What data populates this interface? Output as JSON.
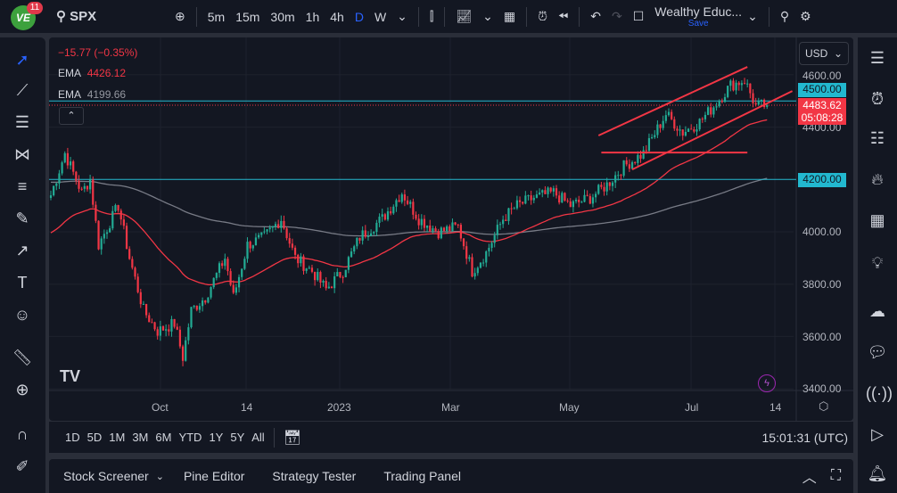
{
  "topbar": {
    "notifications": "11",
    "symbol": "SPX",
    "intervals": [
      "5m",
      "15m",
      "30m",
      "1h",
      "4h",
      "D",
      "W"
    ],
    "active_interval": "D",
    "layout_name": "Wealthy Educ...",
    "save_label": "Save"
  },
  "legend": {
    "change": "−15.77 (−0.35%)",
    "ema1_label": "EMA",
    "ema1_value": "4426.12",
    "ema2_label": "EMA",
    "ema2_value": "4199.66"
  },
  "price_axis": {
    "currency": "USD",
    "labels": [
      "4600.00",
      "4400.00",
      "4000.00",
      "3800.00",
      "3600.00",
      "3400.00"
    ],
    "tag_4500": "4500.00",
    "tag_4200": "4200.00",
    "last_price": "4483.62",
    "countdown": "05:08:28"
  },
  "time_axis": {
    "labels": [
      "Oct",
      "14",
      "2023",
      "Mar",
      "May",
      "Jul",
      "14"
    ]
  },
  "range_bar": {
    "ranges": [
      "1D",
      "5D",
      "1M",
      "3M",
      "6M",
      "YTD",
      "1Y",
      "5Y",
      "All"
    ],
    "clock": "15:01:31 (UTC)"
  },
  "bottom_panel": {
    "tabs": [
      "Stock Screener",
      "Pine Editor",
      "Strategy Tester",
      "Trading Panel"
    ]
  },
  "colors": {
    "up": "#22ab94",
    "down": "#f23645",
    "ema_fast": "#f23645",
    "ema_slow": "#787b86",
    "hline": "#22b8cf",
    "accent": "#2962ff"
  },
  "chart_data": {
    "type": "candlestick",
    "symbol": "SPX",
    "timeframe": "D",
    "ylim": [
      3350,
      4700
    ],
    "keypoints_day_price": [
      [
        0,
        4140
      ],
      [
        5,
        4300
      ],
      [
        11,
        4150
      ],
      [
        14,
        4200
      ],
      [
        17,
        3950
      ],
      [
        24,
        4100
      ],
      [
        28,
        3900
      ],
      [
        33,
        3700
      ],
      [
        38,
        3620
      ],
      [
        44,
        3650
      ],
      [
        47,
        3520
      ],
      [
        50,
        3700
      ],
      [
        55,
        3750
      ],
      [
        62,
        3900
      ],
      [
        65,
        3750
      ],
      [
        70,
        3950
      ],
      [
        76,
        3980
      ],
      [
        82,
        4050
      ],
      [
        87,
        3900
      ],
      [
        93,
        3850
      ],
      [
        98,
        3780
      ],
      [
        104,
        3850
      ],
      [
        110,
        3980
      ],
      [
        118,
        4050
      ],
      [
        125,
        4150
      ],
      [
        131,
        4050
      ],
      [
        138,
        4000
      ],
      [
        145,
        4020
      ],
      [
        150,
        3850
      ],
      [
        155,
        3920
      ],
      [
        161,
        4050
      ],
      [
        166,
        4100
      ],
      [
        172,
        4130
      ],
      [
        179,
        4150
      ],
      [
        185,
        4100
      ],
      [
        192,
        4130
      ],
      [
        198,
        4180
      ],
      [
        204,
        4250
      ],
      [
        211,
        4300
      ],
      [
        219,
        4450
      ],
      [
        225,
        4380
      ],
      [
        231,
        4420
      ],
      [
        236,
        4480
      ],
      [
        242,
        4560
      ],
      [
        247,
        4580
      ],
      [
        251,
        4480
      ],
      [
        255,
        4484
      ]
    ],
    "horizontal_lines": [
      4500,
      4200
    ],
    "trendlines": [
      {
        "from": [
          195,
          4368
        ],
        "to": [
          248,
          4630
        ]
      },
      {
        "from": [
          207,
          4238
        ],
        "to": [
          264,
          4538
        ]
      },
      {
        "from": [
          196,
          4303
        ],
        "to": [
          248,
          4303
        ]
      }
    ],
    "ema_periods": [
      50,
      200
    ]
  }
}
